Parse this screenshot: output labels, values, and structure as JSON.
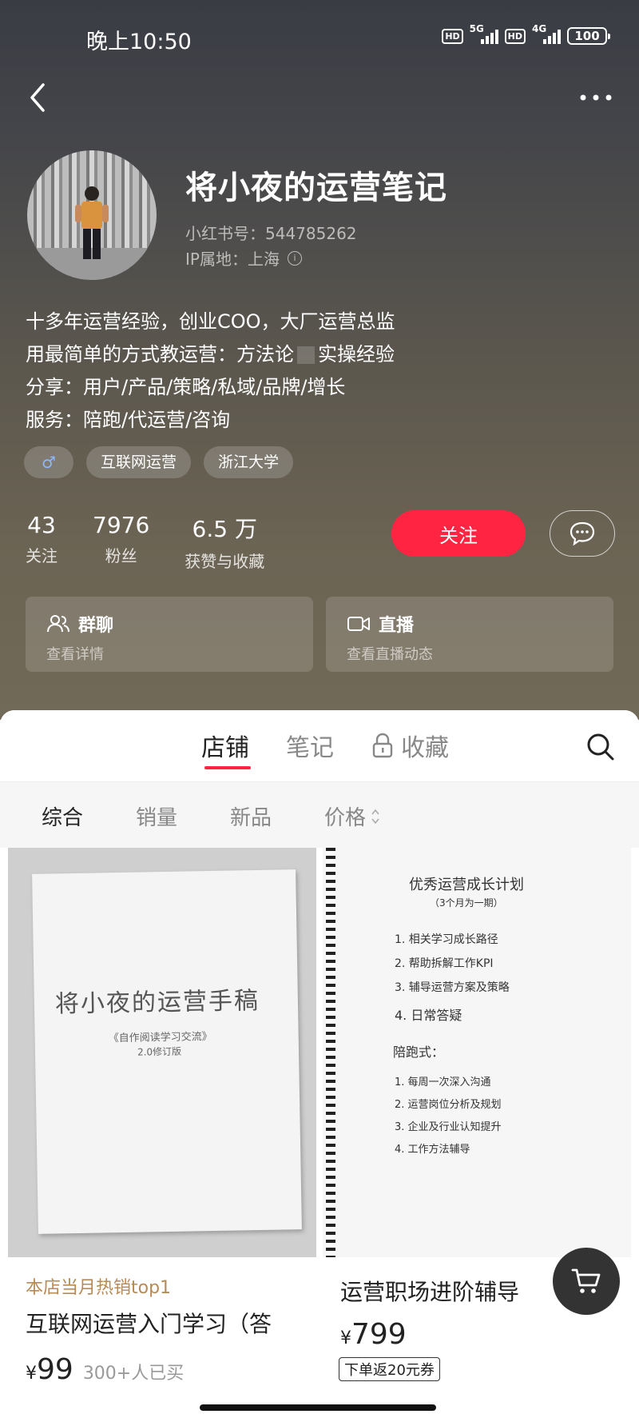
{
  "status_bar": {
    "time": "晚上10:50",
    "hd_label": "HD",
    "net1": "5G",
    "net2": "4G",
    "battery": "100"
  },
  "profile": {
    "name": "将小夜的运营笔记",
    "red_id": "小红书号：544785262",
    "ip_location": "IP属地：上海",
    "bio_lines": [
      "十多年运营经验，创业COO，大厂运营总监",
      "用最简单的方式教运营：方法论",
      "实操经验",
      "分享：用户/产品/策略/私域/品牌/增长",
      "服务：陪跑/代运营/咨询"
    ],
    "tags": {
      "gender_symbol": "♂",
      "tag1": "互联网运营",
      "tag2": "浙江大学"
    }
  },
  "stats": [
    {
      "num": "43",
      "label": "关注"
    },
    {
      "num": "7976",
      "label": "粉丝"
    },
    {
      "num": "6.5 万",
      "label": "获赞与收藏"
    }
  ],
  "actions": {
    "follow": "关注"
  },
  "cards": {
    "group": {
      "title": "群聊",
      "subtitle": "查看详情"
    },
    "live": {
      "title": "直播",
      "subtitle": "查看直播动态"
    }
  },
  "tabs": {
    "shop": "店铺",
    "notes": "笔记",
    "collect": "收藏"
  },
  "filters": {
    "all": "综合",
    "sales": "销量",
    "new": "新品",
    "price": "价格"
  },
  "products": [
    {
      "badge": "本店当月热销top1",
      "title": "互联网运营入门学习（答",
      "yen": "¥",
      "price": "99",
      "sold": "300+人已买"
    },
    {
      "title": "运营职场进阶辅导",
      "yen": "¥",
      "price": "799",
      "coupon": "下单返20元券"
    }
  ],
  "handwriting": {
    "book_title": "将小夜的运营手稿",
    "book_sub1": "《自作阅读学习交流》",
    "book_sub2": "2.0修订版",
    "plan_title": "优秀运营成长计划",
    "plan_sub": "（3个月为一期）",
    "plan_items": [
      "1. 相关学习成长路径",
      "2. 帮助拆解工作KPI",
      "3. 辅导运营方案及策略",
      "4. 日常答疑"
    ],
    "plan_h2": "陪跑式：",
    "plan_items2": [
      "1. 每周一次深入沟通",
      "2. 运营岗位分析及规划",
      "3. 企业及行业认知提升",
      "4. 工作方法辅导"
    ]
  }
}
